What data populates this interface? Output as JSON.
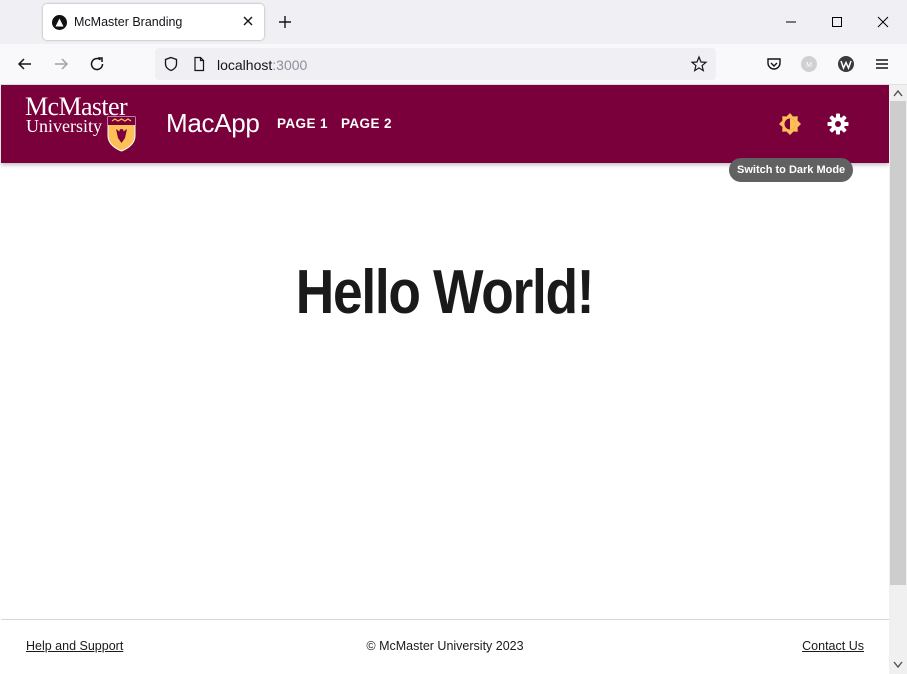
{
  "browser": {
    "tab_title": "McMaster Branding",
    "url_host": "localhost",
    "url_port": ":3000",
    "icons": [
      "back-icon",
      "forward-icon",
      "reload-icon",
      "shield-icon",
      "page-icon",
      "bookmark-star-icon",
      "pocket-icon",
      "extension-icon",
      "wordpress-icon",
      "menu-icon"
    ]
  },
  "app": {
    "logo_line1": "McMaster",
    "logo_line2": "University",
    "title": "MacApp",
    "nav": [
      {
        "label": "PAGE 1"
      },
      {
        "label": "PAGE 2"
      }
    ],
    "tooltip": "Switch to Dark Mode",
    "colors": {
      "brand": "#7a003c",
      "gold": "#fdbf57"
    }
  },
  "main": {
    "heading": "Hello World!"
  },
  "footer": {
    "help": "Help and Support",
    "copyright": "© McMaster University 2023",
    "contact": "Contact Us"
  }
}
